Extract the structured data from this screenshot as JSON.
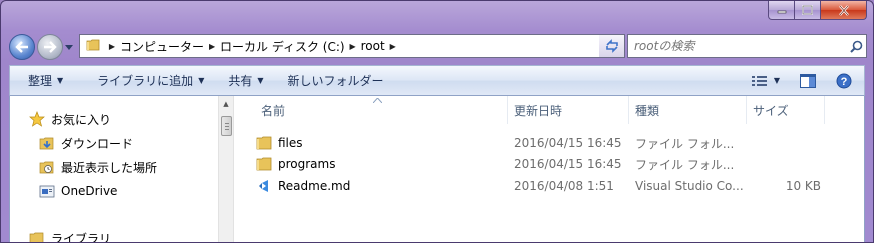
{
  "window": {
    "caption_buttons": [
      "minimize",
      "maximize",
      "close"
    ]
  },
  "address_bar": {
    "breadcrumbs": [
      {
        "label": "コンピューター"
      },
      {
        "label": "ローカル ディスク (C:)"
      },
      {
        "label": "root"
      }
    ]
  },
  "search": {
    "placeholder": "rootの検索"
  },
  "toolbar": {
    "organize": "整理",
    "add_to_library": "ライブラリに追加",
    "share": "共有",
    "new_folder": "新しいフォルダー"
  },
  "navigation": {
    "items": [
      {
        "label": "お気に入り",
        "icon": "star-icon"
      },
      {
        "label": "ダウンロード",
        "icon": "downloads-folder-icon"
      },
      {
        "label": "最近表示した場所",
        "icon": "recent-places-icon"
      },
      {
        "label": "OneDrive",
        "icon": "onedrive-icon"
      },
      {
        "label": "ライブラリ",
        "icon": "library-icon"
      }
    ]
  },
  "columns": {
    "name": "名前",
    "modified": "更新日時",
    "type": "種類",
    "size": "サイズ"
  },
  "files": [
    {
      "name": "files",
      "modified": "2016/04/15 16:45",
      "type": "ファイル フォル...",
      "size": "",
      "icon": "folder-icon"
    },
    {
      "name": "programs",
      "modified": "2016/04/15 16:45",
      "type": "ファイル フォル...",
      "size": "",
      "icon": "folder-icon"
    },
    {
      "name": "Readme.md",
      "modified": "2016/04/08 1:51",
      "type": "Visual Studio Co...",
      "size": "10 KB",
      "icon": "vscode-file-icon"
    }
  ],
  "colors": {
    "frame": "#a48ccf",
    "command_bar": "#dce6f5",
    "header_text": "#4c607a",
    "secondary_text": "#6d6d6d",
    "folder": "#e8c35a"
  }
}
